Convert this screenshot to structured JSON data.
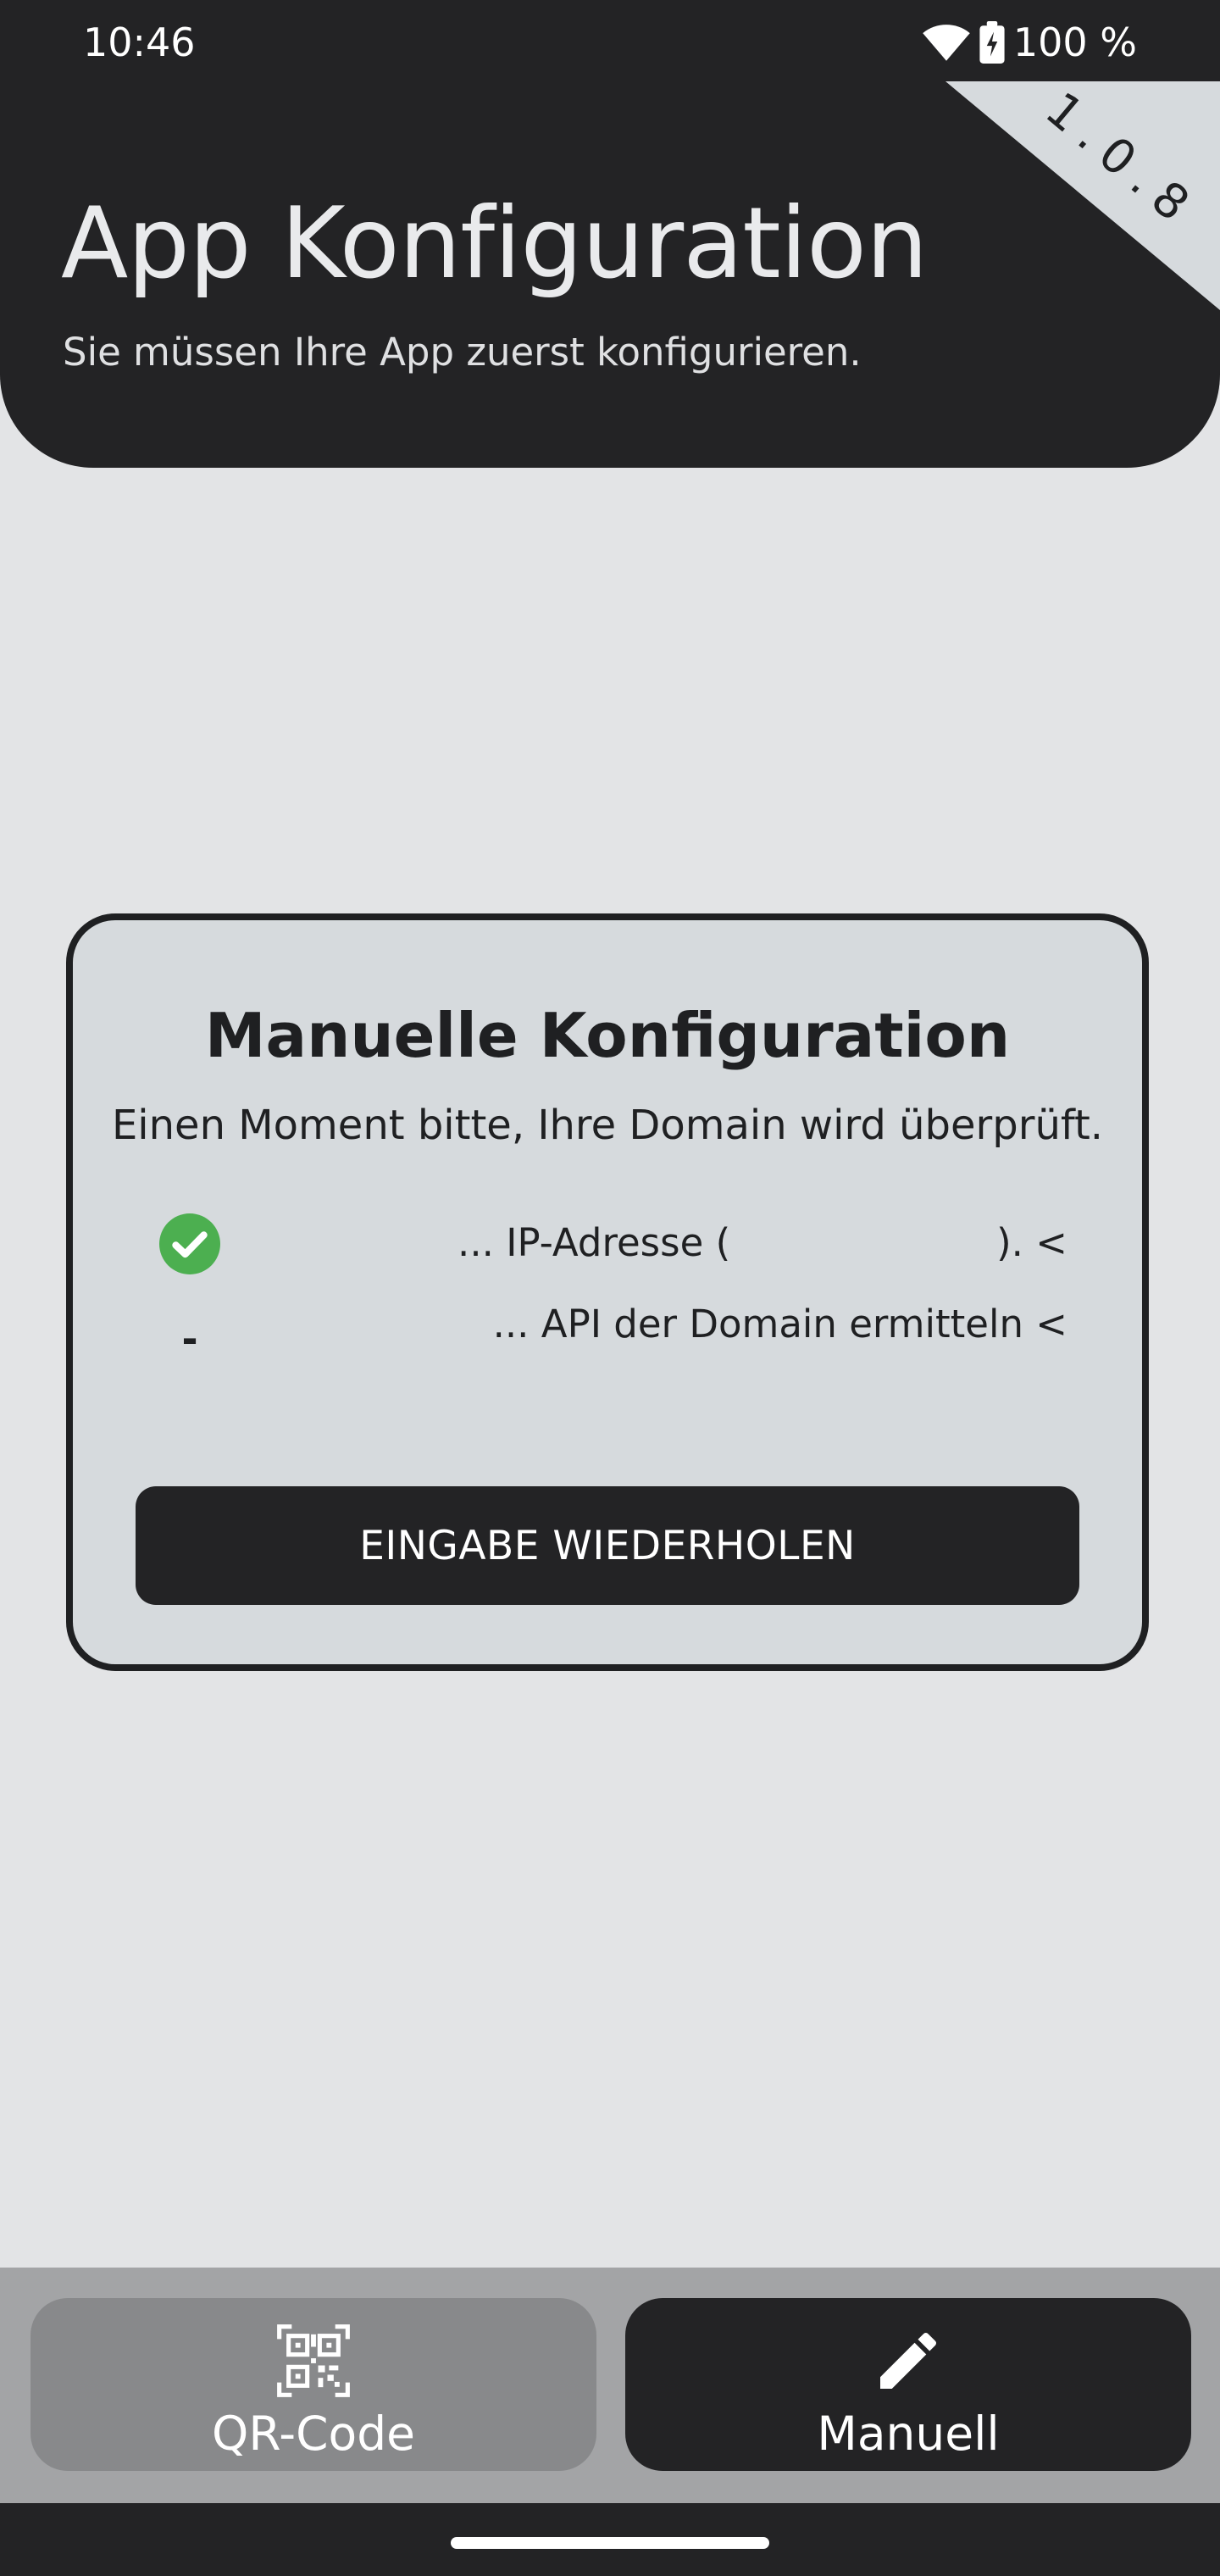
{
  "status_bar": {
    "time": "10:46",
    "battery_text": "100 %",
    "icons": [
      "wifi-icon",
      "battery-charging-icon"
    ]
  },
  "header": {
    "version": "1.0.8",
    "title": "App Konfiguration",
    "subtitle": "Sie müssen Ihre App zuerst konfigurieren."
  },
  "card": {
    "title": "Manuelle Konfiguration",
    "message": "Einen Moment bitte, Ihre Domain wird überprüft.",
    "checks": [
      {
        "status": "done",
        "icon": "check-circle-icon",
        "text_before": "... IP-Adresse (",
        "text_after": "). <"
      },
      {
        "status": "pending",
        "icon": "pending-dash",
        "marker": "-",
        "text": "... API der Domain ermitteln <"
      }
    ],
    "retry_label": "EINGABE WIEDERHOLEN"
  },
  "bottom_nav": {
    "tabs": [
      {
        "label": "QR-Code",
        "icon": "qr-code-icon",
        "active": false
      },
      {
        "label": "Manuell",
        "icon": "pencil-icon",
        "active": true
      }
    ]
  },
  "colors": {
    "dark": "#232325",
    "background": "#e3e4e6",
    "card_background": "#d6dadd",
    "ribbon": "#d6dadd",
    "success_green": "#4caf50",
    "bottom_bar": "#a3a4a6",
    "inactive_tab": "#88898b"
  }
}
